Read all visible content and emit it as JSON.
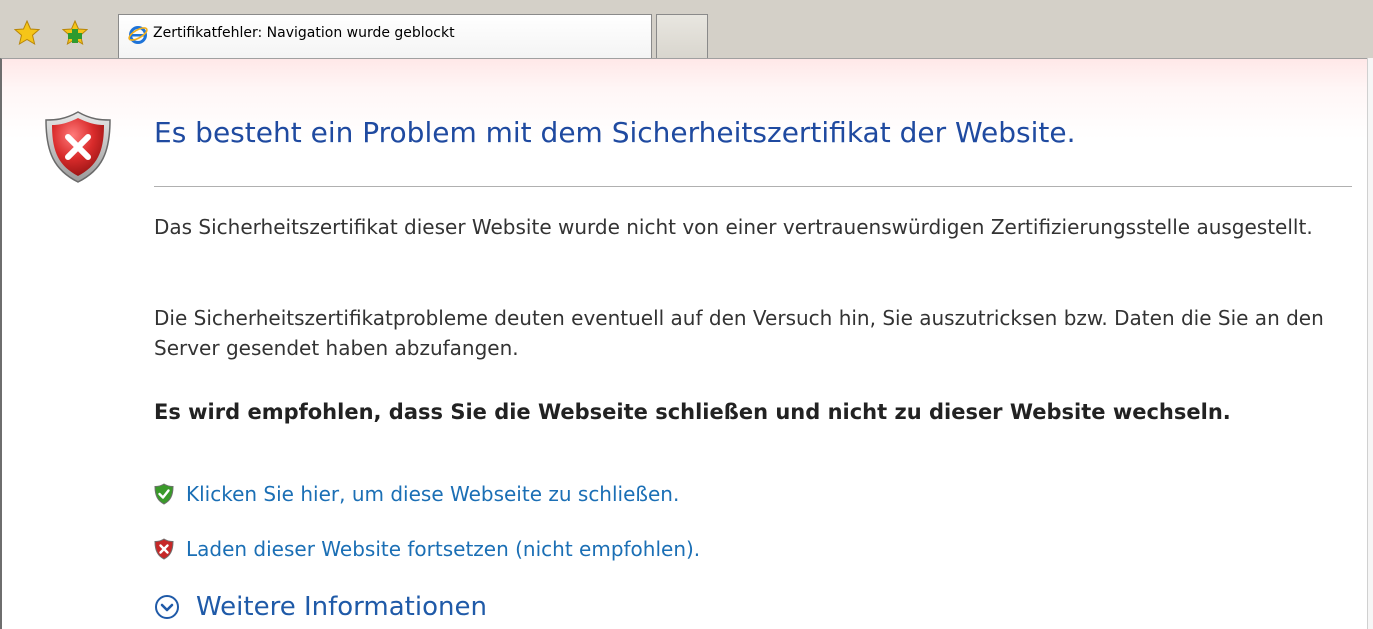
{
  "toolbar": {
    "favorites_icon": "favorites-star-icon",
    "add_favorites_icon": "add-to-favorites-icon"
  },
  "tabs": [
    {
      "title": "Zertifikatfehler: Navigation wurde geblockt",
      "icon": "ie-logo-icon",
      "active": true
    },
    {
      "title": "",
      "icon": "",
      "active": false
    }
  ],
  "page": {
    "headline": "Es besteht ein Problem mit dem Sicherheitszertifikat der Website.",
    "paragraph1": "Das Sicherheitszertifikat dieser Website wurde nicht von einer vertrauenswürdigen Zertifizierungsstelle ausgestellt.",
    "paragraph2": "Die Sicherheitszertifikatprobleme deuten eventuell auf den Versuch hin, Sie auszutricksen bzw. Daten die Sie an den Server gesendet haben abzufangen.",
    "recommendation": "Es wird empfohlen, dass Sie die Webseite schließen und nicht zu dieser Website wechseln.",
    "actions": [
      {
        "label": "Klicken Sie hier, um diese Webseite zu schließen.",
        "icon": "green-shield-check-icon"
      },
      {
        "label": "Laden dieser Website fortsetzen (nicht empfohlen).",
        "icon": "red-shield-x-icon"
      }
    ],
    "more_info": "Weitere Informationen"
  },
  "colors": {
    "headline": "#1f4aa0",
    "link": "#1b6fb5",
    "error_red": "#c62828",
    "safe_green": "#3a9a2a"
  }
}
